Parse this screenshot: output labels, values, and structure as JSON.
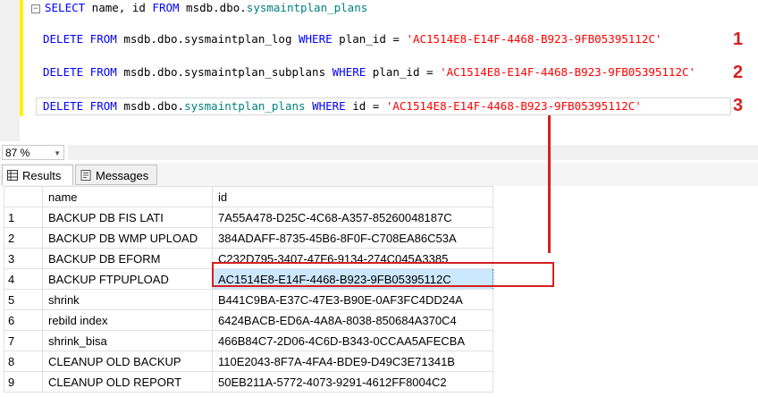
{
  "editor": {
    "lines": [
      {
        "kw1": "SELECT",
        "text1": " name, id ",
        "kw2": "FROM",
        "text2": " msdb.dbo.",
        "table": "sysmaintplan_plans",
        "rest": ""
      },
      {
        "kw1": "DELETE FROM",
        "text1": " msdb.dbo.sysmaintplan_log ",
        "kw2": "WHERE",
        "text2": " plan_id = ",
        "str": "'AC1514E8-E14F-4468-B923-9FB05395112C'"
      },
      {
        "kw1": "DELETE FROM",
        "text1": " msdb.dbo.sysmaintplan_subplans ",
        "kw2": "WHERE",
        "text2": " plan_id = ",
        "str": "'AC1514E8-E14F-4468-B923-9FB05395112C'"
      },
      {
        "kw1": "DELETE FROM",
        "text1": " msdb.dbo.",
        "table": "sysmaintplan_plans",
        "kw2": "WHERE",
        "text2": " id = ",
        "str": "'AC1514E8-E14F-4468-B923-9FB05395112C'"
      }
    ],
    "markers": [
      "1",
      "2",
      "3"
    ]
  },
  "zoom": {
    "value": "87 %"
  },
  "tabs": {
    "results": "Results",
    "messages": "Messages"
  },
  "grid": {
    "headers": [
      "name",
      "id"
    ],
    "rows": [
      {
        "n": "1",
        "name": "BACKUP DB FIS LATI",
        "id": "7A55A478-D25C-4C68-A357-85260048187C"
      },
      {
        "n": "2",
        "name": "BACKUP DB WMP UPLOAD",
        "id": "384ADAFF-8735-45B6-8F0F-C708EA86C53A"
      },
      {
        "n": "3",
        "name": "BACKUP DB EFORM",
        "id": "C232D795-3407-47F6-9134-274C045A3385"
      },
      {
        "n": "4",
        "name": "BACKUP FTPUPLOAD",
        "id": "AC1514E8-E14F-4468-B923-9FB05395112C"
      },
      {
        "n": "5",
        "name": "shrink",
        "id": "B441C9BA-E37C-47E3-B90E-0AF3FC4DD24A"
      },
      {
        "n": "6",
        "name": "rebild index",
        "id": "6424BACB-ED6A-4A8A-8038-850684A370C4"
      },
      {
        "n": "7",
        "name": "shrink_bisa",
        "id": "466B84C7-2D06-4C6D-B343-0CCAA5AFECBA"
      },
      {
        "n": "8",
        "name": "CLEANUP OLD BACKUP",
        "id": "110E2043-8F7A-4FA4-BDE9-D49C3E71341B"
      },
      {
        "n": "9",
        "name": "CLEANUP OLD REPORT",
        "id": "50EB211A-5772-4073-9291-4612FF8004C2"
      }
    ]
  },
  "colors": {
    "keyword": "#0000ff",
    "table": "#008080",
    "string": "#ff0000",
    "annotation": "#d62020",
    "selection": "#cce8ff"
  },
  "icons": {
    "fold": "collapse-icon",
    "results": "grid-icon",
    "messages": "messages-icon"
  }
}
